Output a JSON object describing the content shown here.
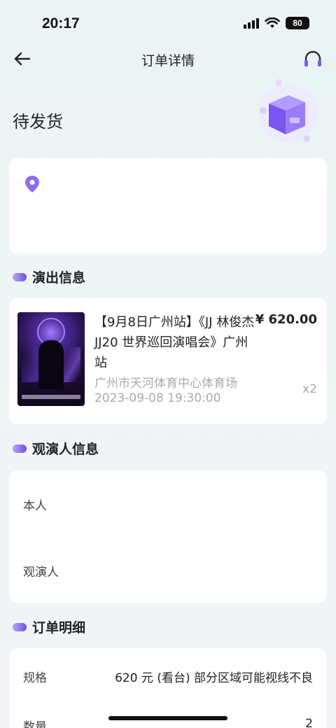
{
  "status_bar": {
    "time": "20:17",
    "battery": "80"
  },
  "nav": {
    "title": "订单详情"
  },
  "order_status": "待发货",
  "sections": {
    "show_info": "演出信息",
    "audience_info": "观演人信息",
    "order_detail": "订单明细"
  },
  "show": {
    "title": "【9月8日广州站】《JJ 林俊杰 JJ20 世界巡回演唱会》广州站",
    "price": "¥ 620.00",
    "venue": "广州市天河体育中心体育场",
    "datetime": "2023-09-08 19:30:00",
    "quantity": "x2"
  },
  "audience": {
    "self_label": "本人",
    "viewer_label": "观演人"
  },
  "detail": {
    "spec_label": "规格",
    "spec_value": "620 元 (看台) 部分区域可能视线不良",
    "qty_label": "数量",
    "qty_value": "2"
  },
  "colors": {
    "accent": "#7b5cf0",
    "muted": "#aaaaaa"
  }
}
